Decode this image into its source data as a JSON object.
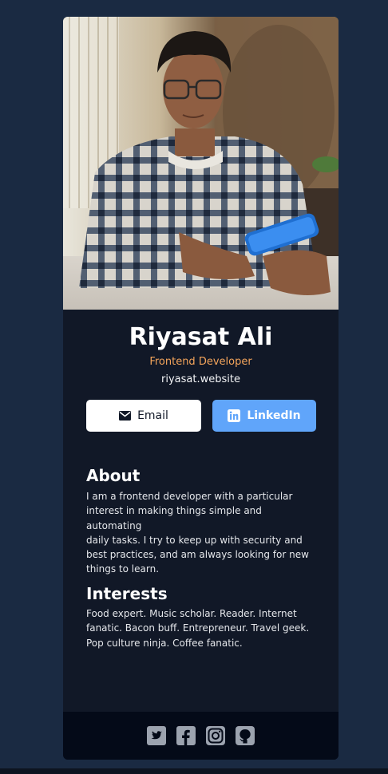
{
  "profile": {
    "photo_alt": "Portrait photo",
    "name": "Riyasat Ali",
    "title": "Frontend Developer",
    "website": "riyasat.website"
  },
  "actions": {
    "email_label": "Email",
    "linkedin_label": "LinkedIn",
    "email_icon": "envelope-icon",
    "linkedin_icon": "linkedin-icon"
  },
  "about": {
    "heading": "About",
    "lines": [
      "I am a frontend developer with a particular",
      "interest in making things simple and automating",
      "daily tasks. I try to keep up with security and",
      "best practices, and am always looking for new",
      "things to learn."
    ]
  },
  "interests": {
    "heading": "Interests",
    "lines": [
      "Food expert. Music scholar. Reader. Internet",
      "fanatic. Bacon buff. Entrepreneur. Travel geek.",
      "Pop culture ninja. Coffee fanatic."
    ]
  },
  "footer": {
    "icons": [
      "twitter-icon",
      "facebook-icon",
      "instagram-icon",
      "github-icon"
    ]
  },
  "colors": {
    "page_background": "#1a2a42",
    "card_background": "#111827",
    "footer_background": "#040a18",
    "accent_orange": "#f5a55b",
    "linkedin_blue": "#60a5fa",
    "social_icon_gray": "#9ca3af"
  }
}
